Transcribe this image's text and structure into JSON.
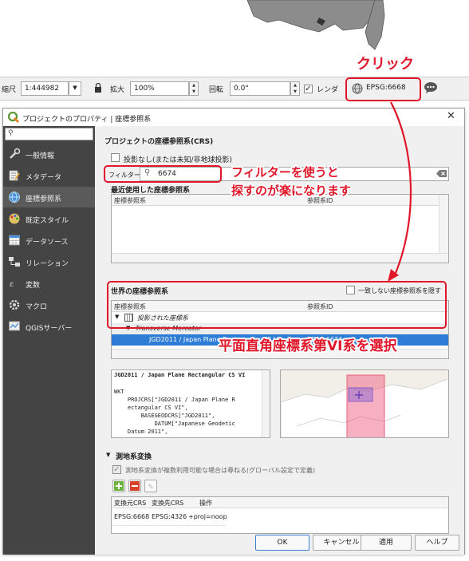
{
  "statusbar": {
    "scale_label": "縮尺",
    "scale_value": "1:444982",
    "magnifier_label": "拡大",
    "magnifier_value": "100%",
    "rotation_label": "回転",
    "rotation_value": "0.0°",
    "render_label": "レンダ",
    "crs_label": "EPSG:6668"
  },
  "annotations": {
    "click": "クリック",
    "filter_tip_line1": "フィルターを使うと",
    "filter_tip_line2": "探すのが楽になります",
    "select_tip": "平面直角座標系第VI系を選択",
    "color": "#e0172a"
  },
  "dialog": {
    "title": "プロジェクトのプロパティ | 座標参照系",
    "sidebar": {
      "search_placeholder": "",
      "items": [
        {
          "label": "一般情報",
          "icon": "wrench-icon"
        },
        {
          "label": "メタデータ",
          "icon": "metadata-icon"
        },
        {
          "label": "座標参照系",
          "icon": "globe-icon"
        },
        {
          "label": "既定スタイル",
          "icon": "palette-icon"
        },
        {
          "label": "データソース",
          "icon": "table-icon"
        },
        {
          "label": "リレーション",
          "icon": "relation-icon"
        },
        {
          "label": "変数",
          "icon": "variables-icon"
        },
        {
          "label": "マクロ",
          "icon": "macro-icon"
        },
        {
          "label": "QGISサーバー",
          "icon": "server-icon"
        }
      ]
    },
    "crs": {
      "section_title": "プロジェクトの座標参照系(CRS)",
      "no_projection_label": "投影なし(または未知/非地球投影)",
      "filter_label": "フィルター",
      "filter_value": "6674",
      "recent_title": "最近使用した座標参照系",
      "recent_headers": [
        "座標参照系",
        "参照系ID"
      ],
      "world_title": "世界の座標参照系",
      "hide_deprecated_label": "一致しない座標参照系を隠す",
      "world_headers": [
        "座標参照系",
        "参照系ID"
      ],
      "tree": [
        {
          "label": "投影された座標系",
          "level": 0
        },
        {
          "label": "Transverse Mercator",
          "level": 1
        },
        {
          "label": "JGD2011 / Japan Plane Rectangular CS VI",
          "id": "EPSG:6674",
          "level": 2,
          "selected": true
        }
      ],
      "wkt_title": "JGD2011 / Japan Plane Rectangular CS VI",
      "wkt_lines": [
        "WKT",
        "    PROJCRS[\"JGD2011 / Japan Plane R",
        "    ectangular CS VI\",",
        "        BASEGEODCRS[\"JGD2011\",",
        "            DATUM[\"Japanese Geodetic",
        "    Datum 2011\","
      ]
    },
    "datum": {
      "section_title": "測地系変換",
      "ask_label": "測地系変換が複数利用可能な場合は尋ねる(グローバル設定で定義)",
      "headers": [
        "変換元CRS",
        "変換先CRS",
        "操作"
      ],
      "rows": [
        [
          "EPSG:6668",
          "EPSG:4326",
          "+proj=noop"
        ]
      ]
    },
    "buttons": {
      "ok": "OK",
      "cancel": "キャンセル",
      "apply": "適用",
      "help": "ヘルプ"
    }
  }
}
